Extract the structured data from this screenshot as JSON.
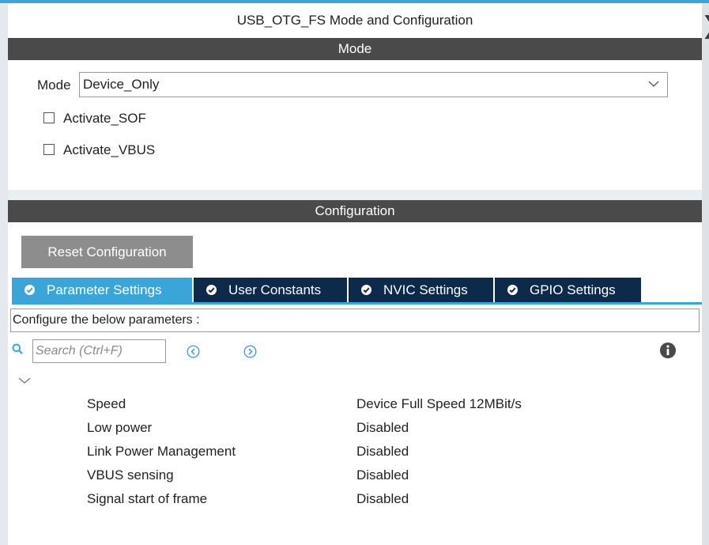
{
  "window": {
    "title": "USB_OTG_FS Mode and Configuration"
  },
  "mode_section": {
    "header": "Mode",
    "mode_label": "Mode",
    "mode_value": "Device_Only",
    "checkboxes": [
      {
        "label": "Activate_SOF",
        "checked": false
      },
      {
        "label": "Activate_VBUS",
        "checked": false
      }
    ]
  },
  "config_section": {
    "header": "Configuration",
    "reset_button": "Reset Configuration",
    "tabs": [
      {
        "label": "Parameter Settings",
        "active": true
      },
      {
        "label": "User Constants",
        "active": false
      },
      {
        "label": "NVIC Settings",
        "active": false
      },
      {
        "label": "GPIO Settings",
        "active": false
      }
    ],
    "configure_text": "Configure the below parameters :",
    "search_placeholder": "Search (Ctrl+F)",
    "parameters": [
      {
        "name": "Speed",
        "value": "Device Full Speed 12MBit/s"
      },
      {
        "name": "Low power",
        "value": "Disabled"
      },
      {
        "name": "Link Power Management",
        "value": "Disabled"
      },
      {
        "name": "VBUS sensing",
        "value": "Disabled"
      },
      {
        "name": "Signal start of frame",
        "value": "Disabled"
      }
    ]
  },
  "colors": {
    "accent": "#3aa5d9",
    "header_bar": "#4a4a4a",
    "tab_inactive": "#0d2a4a",
    "reset_button": "#8d8d8d"
  },
  "icons": {
    "search": "search-icon",
    "previous": "previous-icon",
    "next": "next-icon",
    "info": "info-icon",
    "collapse": "chevron-down-icon",
    "dropdown": "chevron-down-icon",
    "tab_check": "check-circle-icon"
  }
}
